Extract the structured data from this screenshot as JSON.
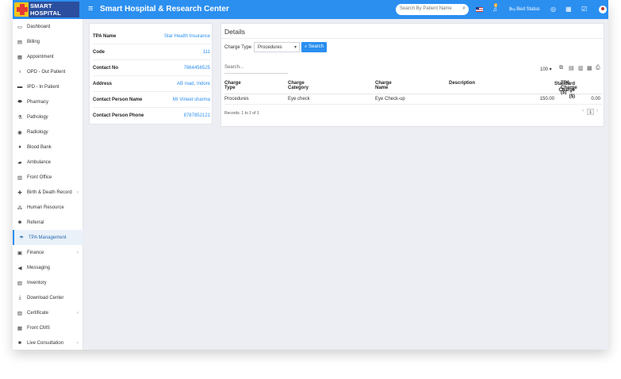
{
  "header": {
    "logo_text": "SMART HOSPITAL",
    "app_title": "Smart Hospital & Research Center",
    "search_placeholder": "Search By Patient Name",
    "notification_badge": "8",
    "bed_status_label": "Bed Status",
    "colors": {
      "header_bg": "#2b8ff0",
      "logo_bg": "#f5c518",
      "accent": "#2b8ff0"
    }
  },
  "sidebar": {
    "items": [
      {
        "label": "Dashboard",
        "icon": "monitor-icon"
      },
      {
        "label": "Billing",
        "icon": "billing-icon"
      },
      {
        "label": "Appointment",
        "icon": "calendar-icon"
      },
      {
        "label": "OPD - Out Patient",
        "icon": "stethoscope-icon"
      },
      {
        "label": "IPD - In Patient",
        "icon": "bed-icon"
      },
      {
        "label": "Pharmacy",
        "icon": "pill-icon"
      },
      {
        "label": "Pathology",
        "icon": "flask-icon"
      },
      {
        "label": "Radiology",
        "icon": "radiology-icon"
      },
      {
        "label": "Blood Bank",
        "icon": "blood-drop-icon"
      },
      {
        "label": "Ambulance",
        "icon": "ambulance-icon"
      },
      {
        "label": "Front Office",
        "icon": "office-icon"
      },
      {
        "label": "Birth & Death Record",
        "icon": "birth-icon",
        "has_children": true
      },
      {
        "label": "Human Resource",
        "icon": "people-tree-icon"
      },
      {
        "label": "Referral",
        "icon": "referral-icon"
      },
      {
        "label": "TPA Management",
        "icon": "umbrella-icon",
        "active": true
      },
      {
        "label": "Finance",
        "icon": "finance-icon",
        "has_children": true
      },
      {
        "label": "Messaging",
        "icon": "megaphone-icon"
      },
      {
        "label": "Inventory",
        "icon": "inventory-icon"
      },
      {
        "label": "Download Center",
        "icon": "download-icon"
      },
      {
        "label": "Certificate",
        "icon": "certificate-icon",
        "has_children": true
      },
      {
        "label": "Front CMS",
        "icon": "cms-icon"
      },
      {
        "label": "Live Consultation",
        "icon": "video-icon",
        "has_children": true
      }
    ]
  },
  "tpa_info": {
    "rows": [
      {
        "label": "TPA Name",
        "value": "Star Health Insurance"
      },
      {
        "label": "Code",
        "value": "111"
      },
      {
        "label": "Contact No",
        "value": "7864456525"
      },
      {
        "label": "Address",
        "value": "AB road, Indore"
      },
      {
        "label": "Contact Person Name",
        "value": "Mr Vineet sharma"
      },
      {
        "label": "Contact Person Phone",
        "value": "8787852121"
      }
    ]
  },
  "details": {
    "title": "Details",
    "charge_type_label": "Charge Type",
    "charge_type_selected": "Procedures",
    "search_button": "Search",
    "table_search_placeholder": "Search...",
    "page_size": "100",
    "columns": [
      "Charge Type",
      "Charge Category",
      "Charge Name",
      "Description",
      "Standard Charge ($)",
      "TPA Charge ($)"
    ],
    "rows": [
      [
        "Procedures",
        "Eye check",
        "Eye Check-up",
        "",
        "150.00",
        "0.00"
      ]
    ],
    "records_text": "Records: 1 to 1 of 1",
    "current_page": "1"
  }
}
